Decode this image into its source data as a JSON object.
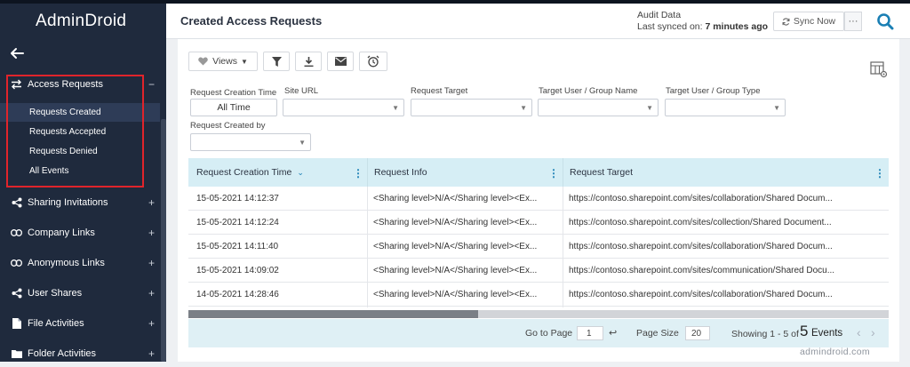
{
  "app": {
    "logo": "AdminDroid"
  },
  "sidebar": {
    "access_requests": {
      "label": "Access Requests",
      "toggle": "−"
    },
    "sub_items": [
      "Requests Created",
      "Requests Accepted",
      "Requests Denied",
      "All Events"
    ],
    "items": [
      {
        "label": "Sharing Invitations",
        "toggle": "+"
      },
      {
        "label": "Company Links",
        "toggle": "+"
      },
      {
        "label": "Anonymous Links",
        "toggle": "+"
      },
      {
        "label": "User Shares",
        "toggle": "+"
      },
      {
        "label": "File Activities",
        "toggle": "+"
      },
      {
        "label": "Folder Activities",
        "toggle": "+"
      }
    ]
  },
  "header": {
    "title": "Created Access Requests",
    "audit_label": "Audit Data",
    "sync_prefix": "Last synced on: ",
    "sync_time": "7 minutes ago",
    "sync_button": "Sync Now",
    "more": "···"
  },
  "toolbar": {
    "views_label": "Views"
  },
  "filters": {
    "request_creation_time": {
      "label": "Request Creation Time",
      "value": "All Time"
    },
    "site_url": {
      "label": "Site URL"
    },
    "request_target": {
      "label": "Request Target"
    },
    "target_user_group_name": {
      "label": "Target User / Group Name"
    },
    "target_user_group_type": {
      "label": "Target User / Group Type"
    },
    "request_created_by": {
      "label": "Request Created by"
    }
  },
  "grid": {
    "columns": [
      "Request Creation Time",
      "Request Info",
      "Request Target"
    ],
    "rows": [
      [
        "15-05-2021 14:12:37",
        "<Sharing level>N/A</Sharing level><Ex...",
        "https://contoso.sharepoint.com/sites/collaboration/Shared Docum..."
      ],
      [
        "15-05-2021 14:12:24",
        "<Sharing level>N/A</Sharing level><Ex...",
        "https://contoso.sharepoint.com/sites/collection/Shared Document..."
      ],
      [
        "15-05-2021 14:11:40",
        "<Sharing level>N/A</Sharing level><Ex...",
        "https://contoso.sharepoint.com/sites/collaboration/Shared Docum..."
      ],
      [
        "15-05-2021 14:09:02",
        "<Sharing level>N/A</Sharing level><Ex...",
        "https://contoso.sharepoint.com/sites/communication/Shared Docu..."
      ],
      [
        "14-05-2021 14:28:46",
        "<Sharing level>N/A</Sharing level><Ex...",
        "https://contoso.sharepoint.com/sites/collaboration/Shared Docum..."
      ]
    ]
  },
  "footer": {
    "go_to_page_label": "Go to Page",
    "page_value": "1",
    "enter_symbol": "↩",
    "page_size_label": "Page Size",
    "page_size_value": "20",
    "showing_prefix": "Showing 1 - 5 of",
    "showing_count": "5",
    "showing_suffix": "Events",
    "prev": "‹",
    "next": "›"
  },
  "watermark": "admindroid.com",
  "colors": {
    "sidebar": "#1f2a3d",
    "accent": "#1a7fb4",
    "highlight": "#e0242b",
    "grid_header": "#d6eef5"
  }
}
